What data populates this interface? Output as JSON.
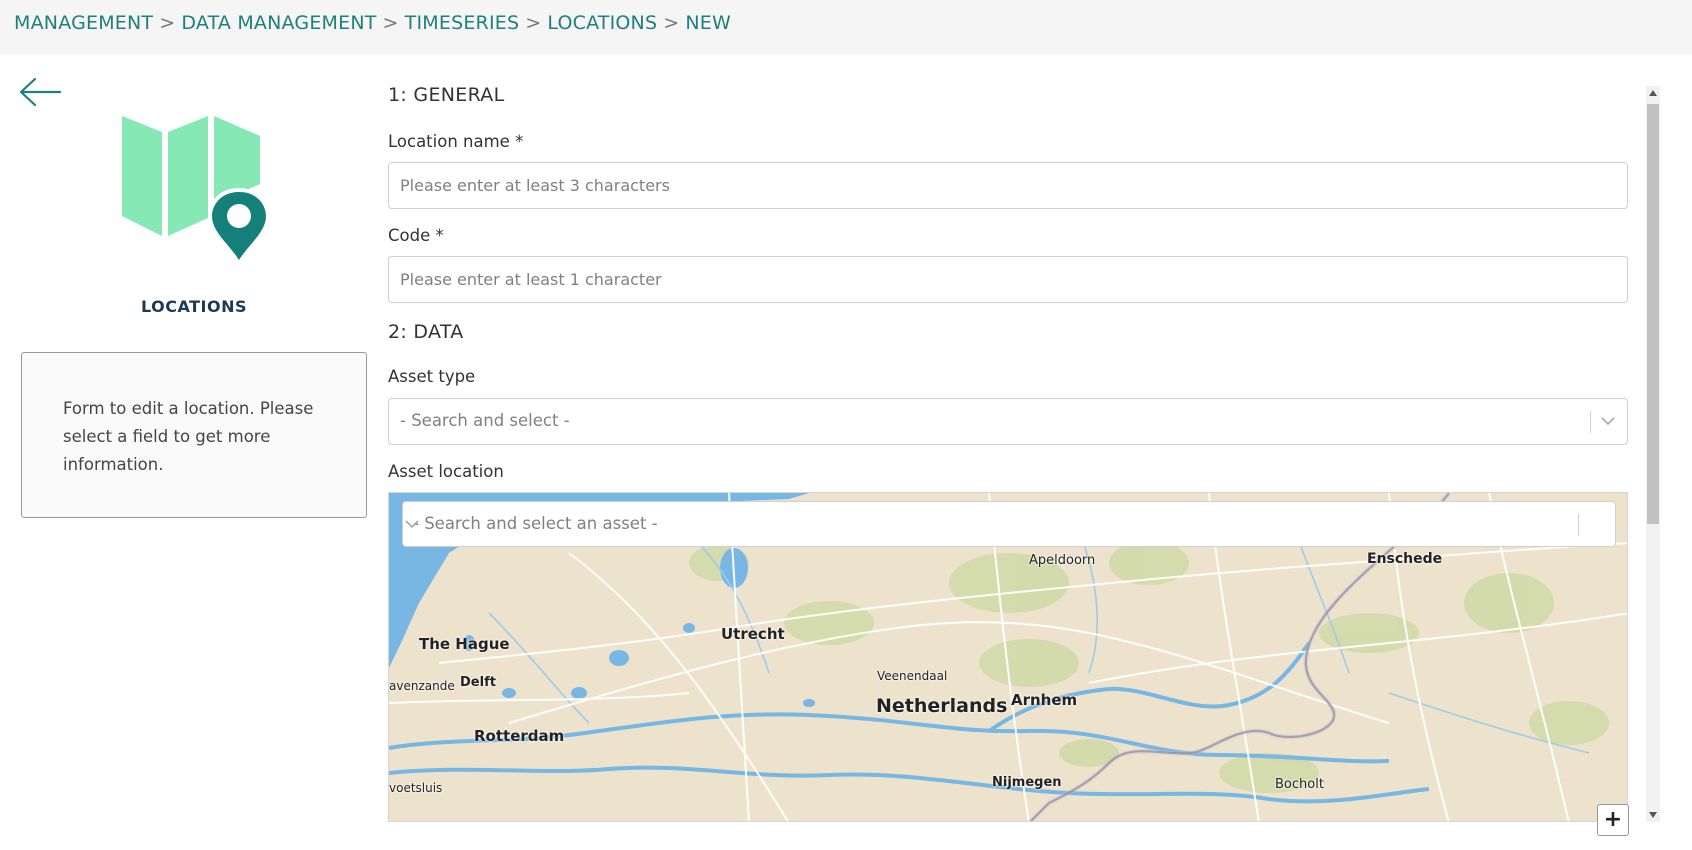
{
  "breadcrumb": {
    "items": [
      "MANAGEMENT",
      "DATA MANAGEMENT",
      "TIMESERIES",
      "LOCATIONS",
      "NEW"
    ],
    "separator": ">"
  },
  "sidebar": {
    "title": "LOCATIONS",
    "info": "Form to edit a location. Please select a field to get more information."
  },
  "form": {
    "section_general": "1: GENERAL",
    "location_name_label": "Location name *",
    "location_name_placeholder": "Please enter at least 3 characters",
    "code_label": "Code *",
    "code_placeholder": "Please enter at least 1 character",
    "section_data": "2: DATA",
    "asset_type_label": "Asset type",
    "asset_type_placeholder": "- Search and select -",
    "asset_location_label": "Asset location",
    "asset_search_placeholder": "- Search and select an asset -"
  },
  "map": {
    "labels": {
      "apeldoorn": "Apeldoorn",
      "enschede": "Enschede",
      "utrecht": "Utrecht",
      "the_hague": "The Hague",
      "zoetermeer": "avenzande",
      "delft": "Delft",
      "veenendaal": "Veenendaal",
      "netherlands": "Netherlands",
      "arnhem": "Arnhem",
      "rotterdam": "Rotterdam",
      "nijmegen": "Nijmegen",
      "bocholt": "Bocholt",
      "voetsluis": "voetsluis"
    },
    "zoom_in": "+"
  },
  "colors": {
    "accent": "#1f7f7c",
    "icon_map_green": "#86e8b5",
    "icon_pin": "#157f7a",
    "water": "#78b6e4"
  }
}
